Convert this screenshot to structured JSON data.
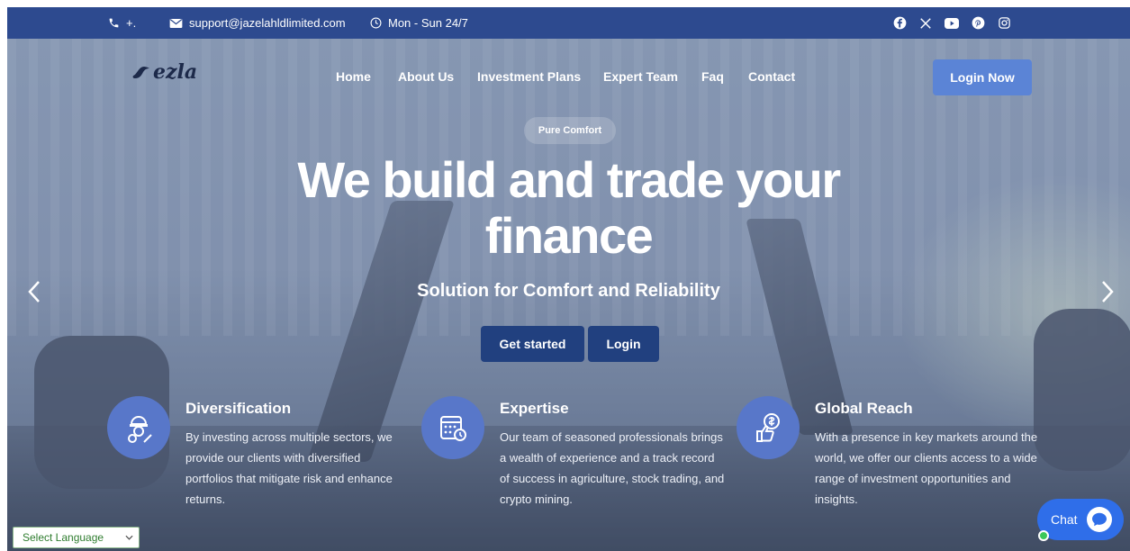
{
  "topbar": {
    "phone": "+.",
    "email": "support@jazelahldlimited.com",
    "hours": "Mon - Sun 24/7",
    "social": [
      "facebook-icon",
      "x-icon",
      "youtube-icon",
      "pinterest-icon",
      "instagram-icon"
    ]
  },
  "brand": {
    "logo_text": "ezla"
  },
  "nav": {
    "items": [
      "Home",
      "About Us",
      "Investment Plans",
      "Expert Team",
      "Faq",
      "Contact"
    ],
    "login_button": "Login Now"
  },
  "hero": {
    "badge": "Pure Comfort",
    "headline_line1": "We build and trade your",
    "headline_line2": "finance",
    "subtitle": "Solution for Comfort and Reliability",
    "primary_button": "Get started",
    "secondary_button": "Login"
  },
  "features": [
    {
      "icon": "engineer-icon",
      "title": "Diversification",
      "text": "By investing across multiple sectors, we provide our clients with diversified portfolios that mitigate risk and enhance returns."
    },
    {
      "icon": "calendar-clock-icon",
      "title": "Expertise",
      "text": "Our team of seasoned professionals brings a wealth of experience and a track record of success in agriculture, stock trading, and crypto mining."
    },
    {
      "icon": "thumbs-up-dollar-icon",
      "title": "Global Reach",
      "text": "With a presence in key markets around the world, we offer our clients access to a wide range of investment opportunities and insights."
    }
  ],
  "language_selector": "Select Language",
  "chat": {
    "label": "Chat"
  },
  "colors": {
    "topbar": "#2d4a8f",
    "accent": "#5b84d6",
    "button": "#21407f",
    "chat": "#2f6ee9"
  }
}
